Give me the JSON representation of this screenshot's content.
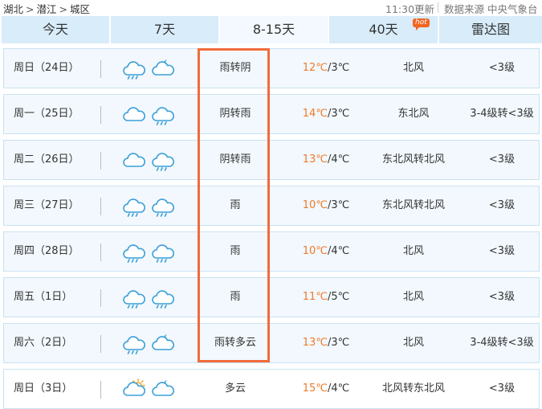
{
  "breadcrumb": {
    "province": "湖北",
    "city": "潜江",
    "district": "城区",
    "separator": ">"
  },
  "update_time": "11:30更新",
  "source": "数据来源 中央气象台",
  "tabs": [
    {
      "label": "今天",
      "active": false
    },
    {
      "label": "7天",
      "active": false
    },
    {
      "label": "8-15天",
      "active": true
    },
    {
      "label": "40天",
      "active": false,
      "badge": "hot"
    },
    {
      "label": "雷达图",
      "active": false
    }
  ],
  "colors": {
    "tab_bg": "#d8ecfa",
    "tab_active_bg": "#f3f9fe",
    "row_bg": "#f2f8fd",
    "row_border": "#c9e1f2",
    "high_temp": "#f07a28",
    "icon_stroke": "#3a9fd8",
    "sun": "#f2a21b",
    "highlight_border": "#f06b3c"
  },
  "forecast": [
    {
      "day": "周日（24日）",
      "icons": [
        "rain-icon",
        "night-cloudy-icon"
      ],
      "desc": "雨转阴",
      "high": "12℃",
      "low": "3℃",
      "wind": "北风",
      "level": "<3级"
    },
    {
      "day": "周一（25日）",
      "icons": [
        "cloudy-icon",
        "rain-icon"
      ],
      "desc": "阴转雨",
      "high": "14℃",
      "low": "3℃",
      "wind": "东北风",
      "level": "3-4级转<3级"
    },
    {
      "day": "周二（26日）",
      "icons": [
        "cloudy-icon",
        "rain-icon"
      ],
      "desc": "阴转雨",
      "high": "13℃",
      "low": "4℃",
      "wind": "东北风转北风",
      "level": "<3级"
    },
    {
      "day": "周三（27日）",
      "icons": [
        "rain-icon",
        "rain-icon"
      ],
      "desc": "雨",
      "high": "10℃",
      "low": "3℃",
      "wind": "东北风转北风",
      "level": "<3级"
    },
    {
      "day": "周四（28日）",
      "icons": [
        "rain-icon",
        "rain-icon"
      ],
      "desc": "雨",
      "high": "10℃",
      "low": "4℃",
      "wind": "北风",
      "level": "<3级"
    },
    {
      "day": "周五（1日）",
      "icons": [
        "rain-icon",
        "rain-icon"
      ],
      "desc": "雨",
      "high": "11℃",
      "low": "5℃",
      "wind": "北风",
      "level": "<3级"
    },
    {
      "day": "周六（2日）",
      "icons": [
        "rain-icon",
        "night-cloudy-icon"
      ],
      "desc": "雨转多云",
      "high": "13℃",
      "low": "3℃",
      "wind": "北风",
      "level": "3-4级转<3级"
    },
    {
      "day": "周日（3日）",
      "icons": [
        "sun-cloudy-icon",
        "night-cloudy-icon"
      ],
      "desc": "多云",
      "high": "15℃",
      "low": "4℃",
      "wind": "北风转东北风",
      "level": "<3级"
    }
  ]
}
